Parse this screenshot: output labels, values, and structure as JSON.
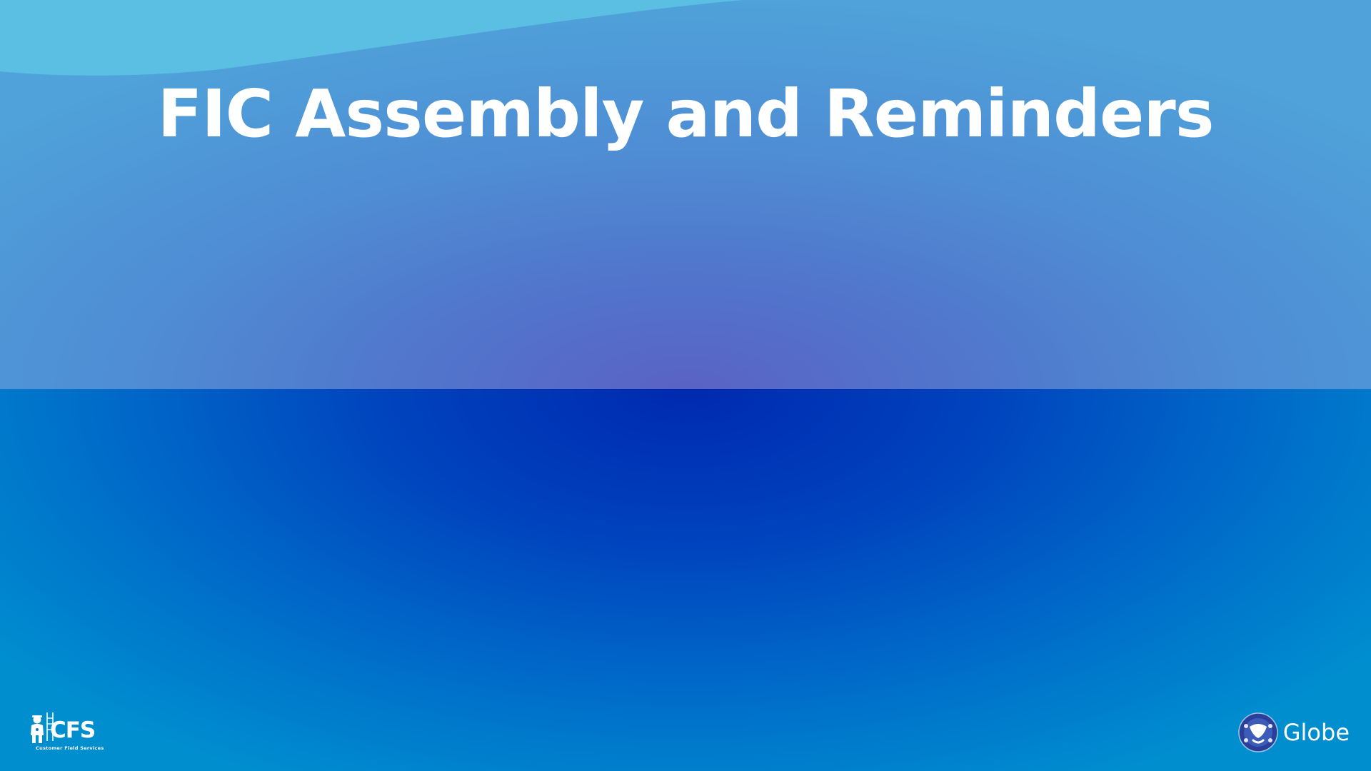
{
  "slide": {
    "title": "FIC Assembly and Reminders"
  },
  "logos": {
    "left": {
      "text": "CFS",
      "subtitle": "Customer Field Services",
      "icon": "technician-ladder-icon"
    },
    "right": {
      "text": "Globe",
      "icon": "globe-logo-icon"
    }
  },
  "colors": {
    "top_panel": "#4f8dd4",
    "bottom_panel": "#0043bd",
    "title_text": "#ffffff"
  }
}
